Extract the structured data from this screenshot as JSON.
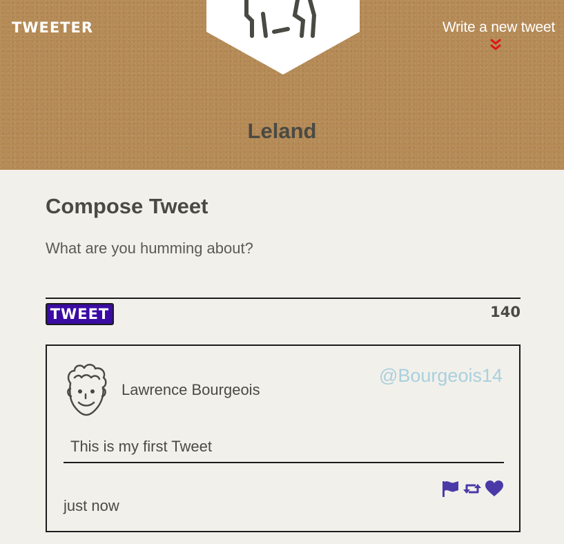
{
  "header": {
    "brand": "TWEETER",
    "write_link": "Write a new tweet",
    "profile_name": "Leland",
    "chevron_color": "#e01414"
  },
  "compose": {
    "title": "Compose Tweet",
    "placeholder": "What are you humming about?",
    "value": "",
    "button_label": "TWEET",
    "char_count": "140",
    "button_color": "#3a0ca3"
  },
  "tweets": [
    {
      "author": "Lawrence Bourgeois",
      "handle": "@Bourgeois14",
      "text": "This is my first Tweet",
      "time": "just now",
      "actions": [
        "flag-icon",
        "retweet-icon",
        "heart-icon"
      ],
      "action_color": "#4a3aa8",
      "handle_color": "#a9d0dd"
    }
  ]
}
